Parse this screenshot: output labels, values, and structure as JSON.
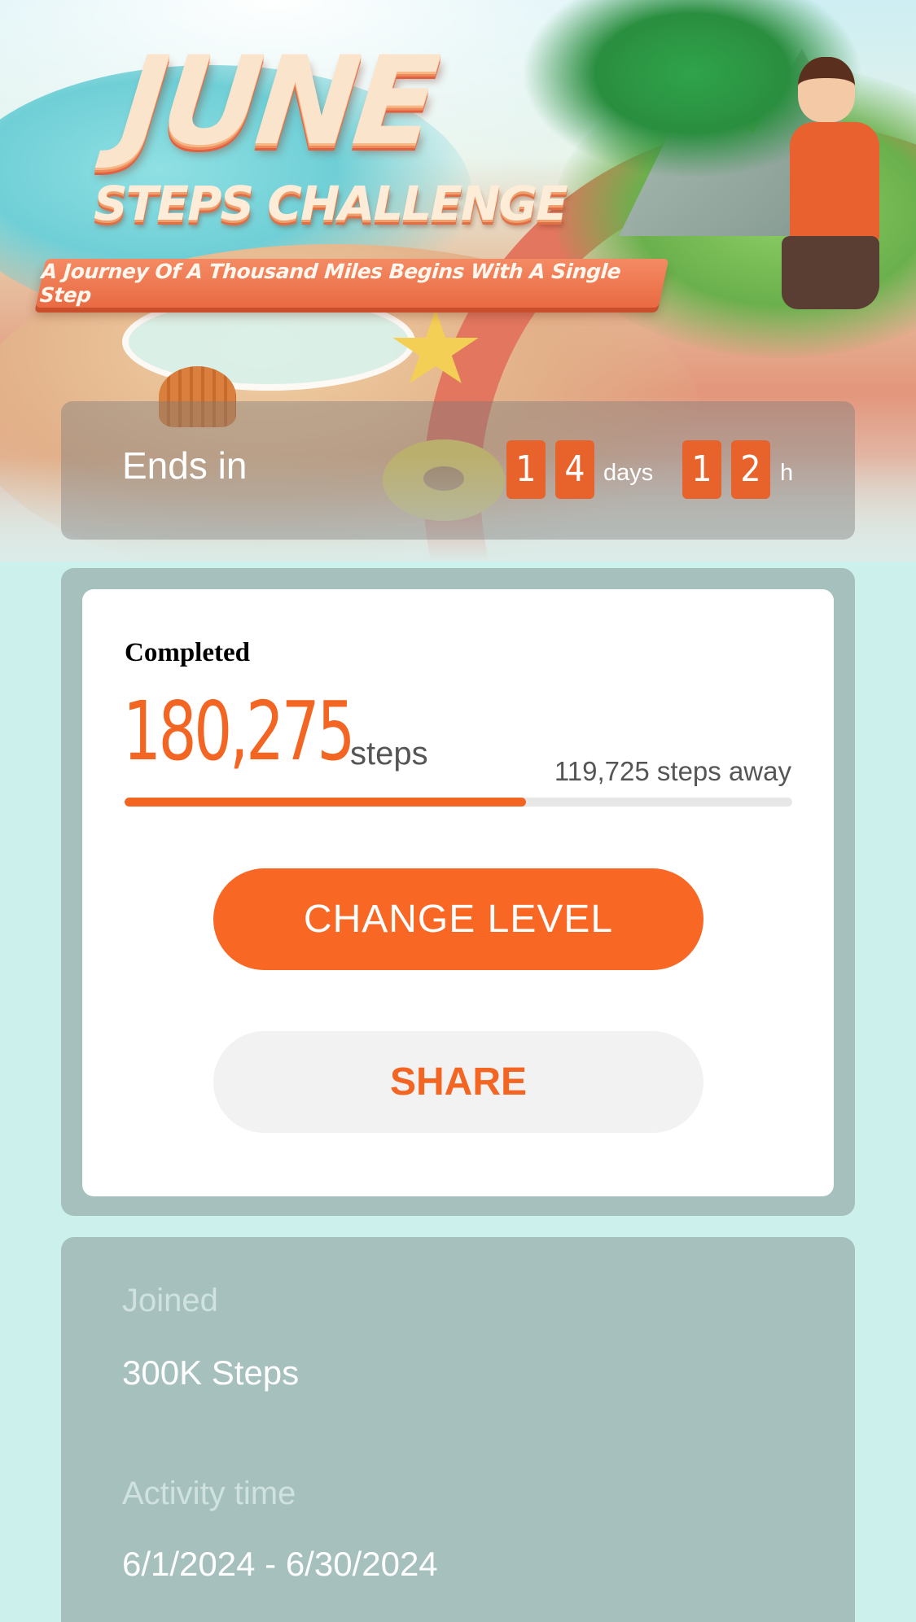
{
  "hero": {
    "title_main": "JUNE",
    "title_sub": "STEPS CHALLENGE",
    "tagline": "A Journey Of A Thousand Miles Begins With A Single Step"
  },
  "countdown": {
    "label": "Ends in",
    "days_digits": [
      "1",
      "4"
    ],
    "days_unit": "days",
    "hours_digits": [
      "1",
      "2"
    ],
    "hours_unit": "h"
  },
  "progress": {
    "label": "Completed",
    "steps_completed": "180,275",
    "steps_unit": "steps",
    "steps_remaining": "119,725 steps away",
    "fraction_complete": 0.6009
  },
  "actions": {
    "change_level": "CHANGE LEVEL",
    "share": "SHARE"
  },
  "info": {
    "joined_label": "Joined",
    "joined_value": "300K Steps",
    "activity_label": "Activity time",
    "activity_value": "6/1/2024 - 6/30/2024"
  },
  "colors": {
    "accent": "#f36523",
    "page_bg": "#ccf0ec",
    "panel_bg": "#a6c1bd"
  }
}
